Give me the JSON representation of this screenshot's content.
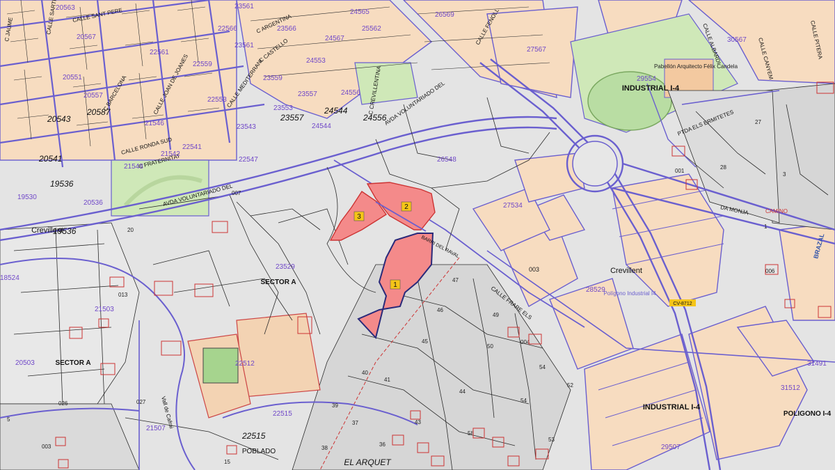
{
  "map": {
    "colors": {
      "urban_block": "#f7dcc0",
      "road_line": "#6a5fcf",
      "parcel_line": "#2b2b2b",
      "park": "#cfe8b8",
      "highlight": "#f48a8a",
      "label_badge": "#f5c518",
      "cadastral_text": "#7048c8"
    },
    "highlighted_plots": [
      {
        "label": "1"
      },
      {
        "label": "2"
      },
      {
        "label": "3"
      }
    ],
    "place_labels": [
      {
        "id": "industrial-north",
        "text": "INDUSTRIAL I-4"
      },
      {
        "id": "industrial-south",
        "text": "INDUSTRIAL I-4"
      },
      {
        "id": "sector-a-1",
        "text": "SECTOR A"
      },
      {
        "id": "sector-a-2",
        "text": "SECTOR A"
      },
      {
        "id": "crevillent-1",
        "text": "Crevillent"
      },
      {
        "id": "crevillent-2",
        "text": "Crevillent"
      },
      {
        "id": "el-arquet",
        "text": "EL ARQUET"
      },
      {
        "id": "poblado",
        "text": "POBLADO"
      },
      {
        "id": "poligono-i4",
        "text": "Polígono Industrial I4"
      },
      {
        "id": "poligono",
        "text": "POLIGONO I-4"
      },
      {
        "id": "pabellon",
        "text": "Pabellón Arquitecto Félix Candela"
      }
    ],
    "street_labels": [
      {
        "id": "sant-pere",
        "text": "CALLE SANT PERE"
      },
      {
        "id": "argentina",
        "text": "C ARGENTINA"
      },
      {
        "id": "castello",
        "text": "C CASTELLO"
      },
      {
        "id": "mediterrani",
        "text": "CALLE MEDITERRANI"
      },
      {
        "id": "barcelona",
        "text": "C BARCELONA"
      },
      {
        "id": "joan-de-joanes",
        "text": "CALLE JOAN DE JOANES"
      },
      {
        "id": "ronda-sud",
        "text": "CALLE RONDA SUD"
      },
      {
        "id": "fraternitat",
        "text": "C FRATERNITAT"
      },
      {
        "id": "voluntariado-1",
        "text": "AVDA VOLUNTARIADO DEL"
      },
      {
        "id": "voluntariado-2",
        "text": "AVDA VOLUNTARIADO DEL"
      },
      {
        "id": "crevillentina",
        "text": "C CREVILLENTINA"
      },
      {
        "id": "fenoll",
        "text": "CALLE FENOLL"
      },
      {
        "id": "albardi",
        "text": "CALLE ALBARDI"
      },
      {
        "id": "canyem",
        "text": "CALLE CANYEM"
      },
      {
        "id": "pitera",
        "text": "CALLE PITERA"
      },
      {
        "id": "ermitetes",
        "text": "PTDA ELS ERMITETES"
      },
      {
        "id": "la-monja",
        "text": "DA MONJA"
      },
      {
        "id": "camino",
        "text": "CAMINO"
      },
      {
        "id": "frare",
        "text": "CALLE FRARE ELS"
      },
      {
        "id": "rayas",
        "text": "BARRI DEL RAVAL"
      },
      {
        "id": "brazal",
        "text": "BRAZAL"
      },
      {
        "id": "vall-de-cafrai",
        "text": "Vall de Cafrai"
      },
      {
        "id": "cv-8712",
        "text": "CV-8712"
      },
      {
        "id": "calle-sarrer",
        "text": "CALLE SARTRE"
      },
      {
        "id": "jaume",
        "text": "C JAUME"
      }
    ],
    "cadastral_numbers": [
      {
        "id": "c20563",
        "text": "20563"
      },
      {
        "id": "c22566",
        "text": "22566"
      },
      {
        "id": "c23561a",
        "text": "23561"
      },
      {
        "id": "c24565",
        "text": "24565"
      },
      {
        "id": "c26569",
        "text": "26569"
      },
      {
        "id": "c30567",
        "text": "30567"
      },
      {
        "id": "c23566",
        "text": "23566"
      },
      {
        "id": "c24562",
        "text": "25562"
      },
      {
        "id": "c27567",
        "text": "27567"
      },
      {
        "id": "c24567",
        "text": "24567"
      },
      {
        "id": "c23561b",
        "text": "23561"
      },
      {
        "id": "c24553",
        "text": "24553"
      },
      {
        "id": "c22561",
        "text": "22561"
      },
      {
        "id": "c20567",
        "text": "20567"
      },
      {
        "id": "c22559",
        "text": "22559"
      },
      {
        "id": "c23559",
        "text": "23559"
      },
      {
        "id": "c24556",
        "text": "24556"
      },
      {
        "id": "c20551",
        "text": "20551"
      },
      {
        "id": "c20557",
        "text": "20557"
      },
      {
        "id": "c22553",
        "text": "22553"
      },
      {
        "id": "c23557",
        "text": "23557"
      },
      {
        "id": "c23553",
        "text": "23553"
      },
      {
        "id": "c29554",
        "text": "29554"
      },
      {
        "id": "c20587",
        "text": "20587"
      },
      {
        "id": "c23557b",
        "text": "23557"
      },
      {
        "id": "c24544",
        "text": "24544"
      },
      {
        "id": "c24556b",
        "text": "24556"
      },
      {
        "id": "c20543",
        "text": "20543"
      },
      {
        "id": "c21546",
        "text": "21546"
      },
      {
        "id": "c23543",
        "text": "23543"
      },
      {
        "id": "c24544b",
        "text": "24544"
      },
      {
        "id": "c22541",
        "text": "22541"
      },
      {
        "id": "c22547",
        "text": "22547"
      },
      {
        "id": "c26548",
        "text": "26548"
      },
      {
        "id": "c20541",
        "text": "20541"
      },
      {
        "id": "c21542",
        "text": "21542"
      },
      {
        "id": "c21548",
        "text": "21548"
      },
      {
        "id": "c19536",
        "text": "19536"
      },
      {
        "id": "c19536b",
        "text": "19536"
      },
      {
        "id": "c20536",
        "text": "20536"
      },
      {
        "id": "c27534",
        "text": "27534"
      },
      {
        "id": "c19530",
        "text": "19530"
      },
      {
        "id": "c23529",
        "text": "23529"
      },
      {
        "id": "c28529",
        "text": "28529"
      },
      {
        "id": "c21503",
        "text": "21503"
      },
      {
        "id": "c20503",
        "text": "20503"
      },
      {
        "id": "c22512",
        "text": "22512"
      },
      {
        "id": "c22515",
        "text": "22515"
      },
      {
        "id": "c22515b",
        "text": "22515"
      },
      {
        "id": "c21507",
        "text": "21507"
      },
      {
        "id": "c29507",
        "text": "29507"
      },
      {
        "id": "c31491",
        "text": "31491"
      },
      {
        "id": "c31512",
        "text": "31512"
      },
      {
        "id": "c18524",
        "text": "18524"
      }
    ],
    "parcel_numbers": [
      {
        "id": "p27",
        "text": "27"
      },
      {
        "id": "p28",
        "text": "28"
      },
      {
        "id": "p3",
        "text": "3"
      },
      {
        "id": "p001",
        "text": "001"
      },
      {
        "id": "p1",
        "text": "1"
      },
      {
        "id": "p47",
        "text": "47"
      },
      {
        "id": "p46",
        "text": "46"
      },
      {
        "id": "p49",
        "text": "49"
      },
      {
        "id": "p45",
        "text": "45"
      },
      {
        "id": "p50",
        "text": "50"
      },
      {
        "id": "p004",
        "text": "004"
      },
      {
        "id": "p54",
        "text": "54"
      },
      {
        "id": "p52",
        "text": "52"
      },
      {
        "id": "p40",
        "text": "40"
      },
      {
        "id": "p41",
        "text": "41"
      },
      {
        "id": "p44",
        "text": "44"
      },
      {
        "id": "p54b",
        "text": "54"
      },
      {
        "id": "p39",
        "text": "39"
      },
      {
        "id": "p37",
        "text": "37"
      },
      {
        "id": "p43",
        "text": "43"
      },
      {
        "id": "p58",
        "text": "58"
      },
      {
        "id": "p53",
        "text": "53"
      },
      {
        "id": "p36",
        "text": "36"
      },
      {
        "id": "p38",
        "text": "38"
      },
      {
        "id": "p003",
        "text": "003"
      },
      {
        "id": "p15",
        "text": "15"
      },
      {
        "id": "p5",
        "text": "5"
      },
      {
        "id": "p013",
        "text": "013"
      },
      {
        "id": "p007",
        "text": "007"
      },
      {
        "id": "p003b",
        "text": "003"
      },
      {
        "id": "p026",
        "text": "026"
      },
      {
        "id": "p027",
        "text": "027"
      },
      {
        "id": "p006",
        "text": "006"
      },
      {
        "id": "p20",
        "text": "20"
      }
    ]
  }
}
